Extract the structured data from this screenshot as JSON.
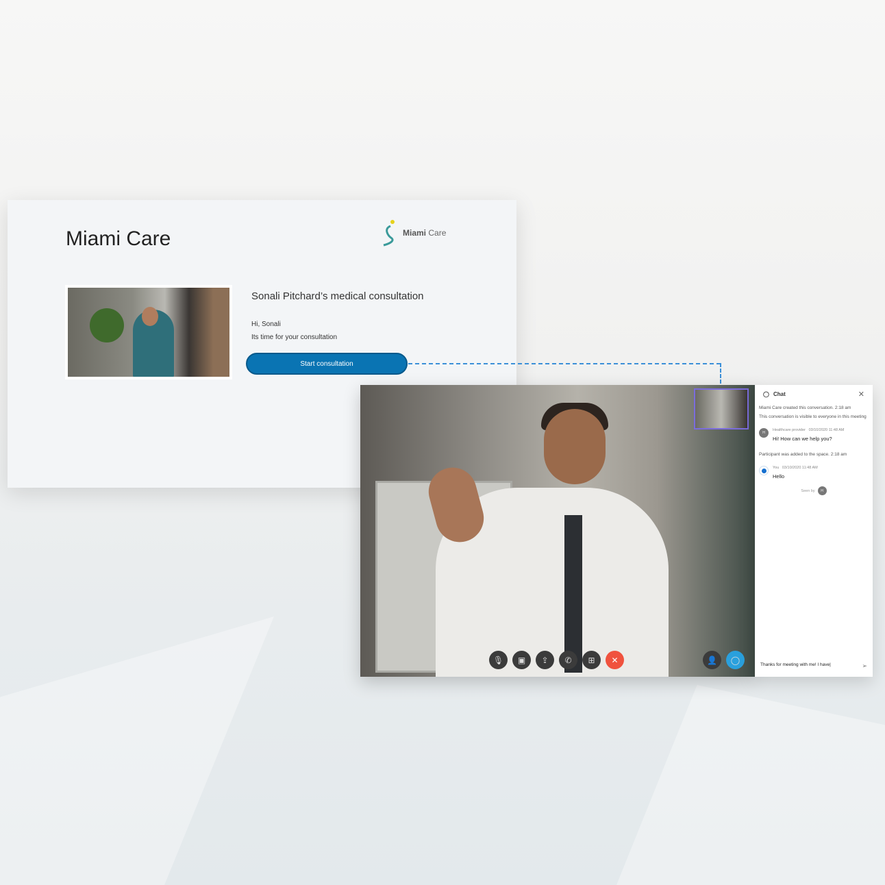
{
  "landing": {
    "title": "Miami Care",
    "logo_brand": "Miami",
    "logo_suffix": "Care",
    "consultation_title": "Sonali Pitchard’s medical consultation",
    "greeting": "Hi, Sonali",
    "subtitle": "Its time for your consultation",
    "start_button": "Start consultation"
  },
  "call": {
    "controls": [
      {
        "name": "mute",
        "icon": "mic-off-icon",
        "glyph": "🎙"
      },
      {
        "name": "video",
        "icon": "video-off-icon",
        "glyph": "▣"
      },
      {
        "name": "share",
        "icon": "share-icon",
        "glyph": "⇪"
      },
      {
        "name": "audio",
        "icon": "phone-icon",
        "glyph": "✆"
      },
      {
        "name": "layout",
        "icon": "layout-icon",
        "glyph": "⊞"
      },
      {
        "name": "end",
        "icon": "end-call-icon",
        "glyph": "✕"
      }
    ],
    "right_controls": [
      {
        "name": "participants",
        "icon": "participants-icon",
        "glyph": "👤"
      },
      {
        "name": "chat",
        "icon": "chat-icon",
        "glyph": "◯"
      }
    ]
  },
  "chat": {
    "title": "Chat",
    "system_1": "Miami Care created this conversation. 2:18 am",
    "system_2": "This conversation is visible to everyone in this meeting",
    "messages": [
      {
        "avatar": "H",
        "sender": "Healthcare provider",
        "time": "03/10/2020 11:48 AM",
        "text": "Hi! How can we help you?"
      },
      {
        "sender": "You",
        "time": "03/10/2020 11:48 AM",
        "text": "Hello"
      }
    ],
    "system_3": "Participant was added to the space. 2:18 am",
    "seen_by": "Seen by",
    "seen_avatar": "H",
    "input_value": "Thanks for meeting with me! I have|"
  },
  "colors": {
    "accent": "#0a74b3",
    "end_call": "#f0523e",
    "chat_active": "#2aa0dd",
    "dash": "#3a8fd8"
  }
}
